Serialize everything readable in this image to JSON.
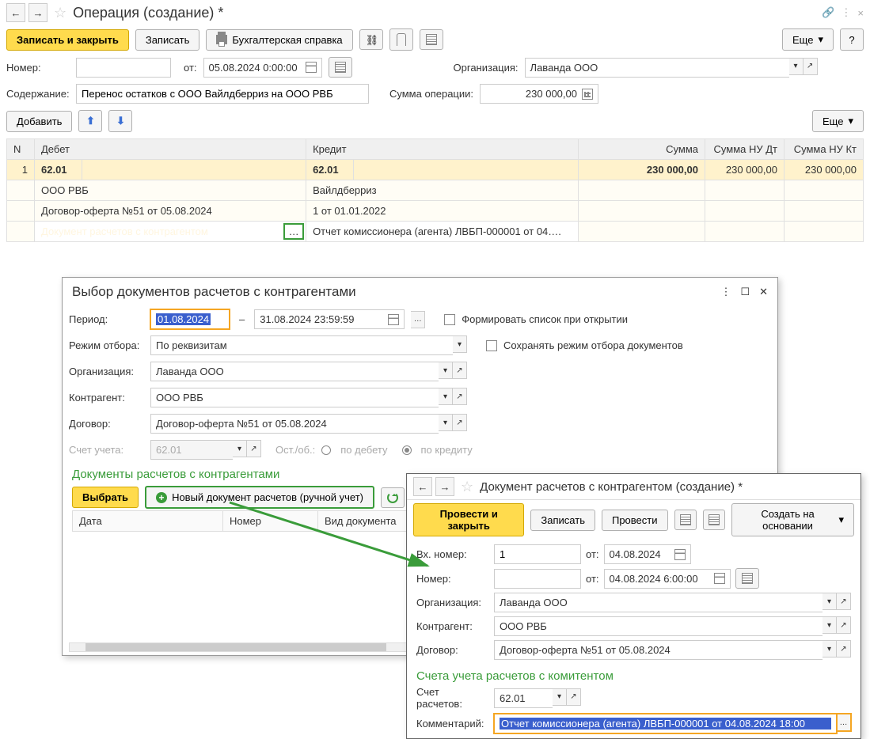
{
  "header": {
    "title": "Операция (создание) *"
  },
  "toolbar": {
    "save_close": "Записать и закрыть",
    "save": "Записать",
    "print_ref": "Бухгалтерская справка",
    "more": "Еще"
  },
  "fields": {
    "number_label": "Номер:",
    "from_label": "от:",
    "date_value": "05.08.2024  0:00:00",
    "org_label": "Организация:",
    "org_value": "Лаванда ООО",
    "content_label": "Содержание:",
    "content_value": "Перенос остатков с ООО Вайлдберриз на ООО РВБ",
    "sum_label": "Сумма операции:",
    "sum_value": "230 000,00",
    "add": "Добавить",
    "more": "Еще"
  },
  "grid": {
    "col_n": "N",
    "col_debit": "Дебет",
    "col_credit": "Кредит",
    "col_sum": "Сумма",
    "col_nu_dt": "Сумма НУ Дт",
    "col_nu_kt": "Сумма НУ Кт",
    "rows": {
      "n": "1",
      "debit_acc": "62.01",
      "credit_acc": "62.01",
      "sum": "230 000,00",
      "nu_dt": "230 000,00",
      "nu_kt": "230 000,00",
      "debit_s1": "ООО РВБ",
      "credit_s1": "Вайлдберриз",
      "debit_s2": "Договор-оферта №51 от 05.08.2024",
      "credit_s2": "1 от 01.01.2022",
      "debit_s3_ghost": "Документ расчетов с контрагентом",
      "credit_s3": "Отчет комиссионера (агента) ЛВБП-000001 от 04…."
    }
  },
  "modal1": {
    "title": "Выбор документов расчетов с контрагентами",
    "period_label": "Период:",
    "date_from": "01.08.2024",
    "date_to": "31.08.2024 23:59:59",
    "cb_form_list": "Формировать список при открытии",
    "mode_label": "Режим отбора:",
    "mode_value": "По реквизитам",
    "cb_keep_mode": "Сохранять режим отбора документов",
    "org_label": "Организация:",
    "org_value": "Лаванда ООО",
    "kontr_label": "Контрагент:",
    "kontr_value": "ООО РВБ",
    "dog_label": "Договор:",
    "dog_value": "Договор-оферта №51 от 05.08.2024",
    "acc_label": "Счет учета:",
    "acc_value": "62.01",
    "ost_label": "Ост./об.:",
    "ost_debit": "по дебету",
    "ost_credit": "по кредиту",
    "docs_title": "Документы расчетов с контрагентами",
    "btn_select": "Выбрать",
    "btn_new_doc": "Новый документ расчетов (ручной учет)",
    "col_date": "Дата",
    "col_num": "Номер",
    "col_doc_type": "Вид документа"
  },
  "modal2": {
    "title": "Документ расчетов с контрагентом (создание) *",
    "btn_post_close": "Провести и закрыть",
    "btn_save": "Записать",
    "btn_post": "Провести",
    "btn_create_base": "Создать на основании",
    "in_num_label": "Вх. номер:",
    "in_num_value": "1",
    "from_label": "от:",
    "in_date": "04.08.2024",
    "num_label": "Номер:",
    "num_date": "04.08.2024  6:00:00",
    "org_label": "Организация:",
    "org_value": "Лаванда ООО",
    "kontr_label": "Контрагент:",
    "kontr_value": "ООО РВБ",
    "dog_label": "Договор:",
    "dog_value": "Договор-оферта №51 от 05.08.2024",
    "section_title": "Счета учета расчетов с комитентом",
    "acc_label": "Счет расчетов:",
    "acc_value": "62.01",
    "comment_label": "Комментарий:",
    "comment_value": "Отчет комиссионера (агента) ЛВБП-000001 от 04.08.2024 18:00"
  }
}
